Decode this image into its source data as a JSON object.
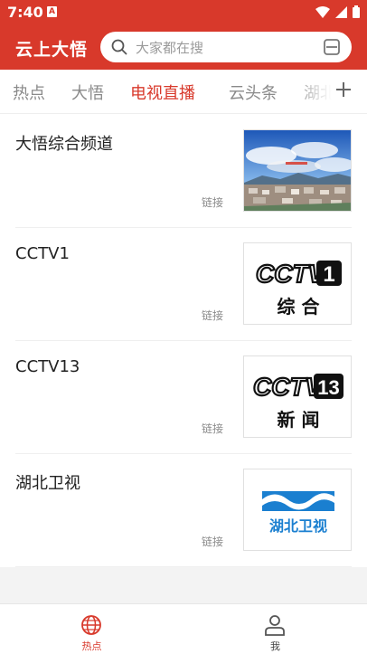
{
  "status_bar": {
    "time": "7:40",
    "notification_badge": "A"
  },
  "header": {
    "app_title": "云上大悟",
    "search_placeholder": "大家都在搜"
  },
  "tabs": [
    {
      "label": "热点"
    },
    {
      "label": "大悟"
    },
    {
      "label": "电视直播",
      "active": true
    },
    {
      "label": "云头条"
    },
    {
      "label": "湖北"
    }
  ],
  "items": [
    {
      "title": "大悟综合频道",
      "tag": "链接",
      "thumb": "town-landscape-image"
    },
    {
      "title": "CCTV1",
      "tag": "链接",
      "thumb": "cctv1-logo",
      "logo_number": "1",
      "logo_sub": "综 合"
    },
    {
      "title": "CCTV13",
      "tag": "链接",
      "thumb": "cctv13-logo",
      "logo_number": "13",
      "logo_sub": "新 闻"
    },
    {
      "title": "湖北卫视",
      "tag": "链接",
      "thumb": "hubei-tv-logo",
      "logo_text": "湖北卫视"
    }
  ],
  "bottom_nav": [
    {
      "label": "热点",
      "active": true
    },
    {
      "label": "我"
    }
  ],
  "colors": {
    "accent": "#d8392b",
    "hubei_blue": "#1a7fd0"
  }
}
